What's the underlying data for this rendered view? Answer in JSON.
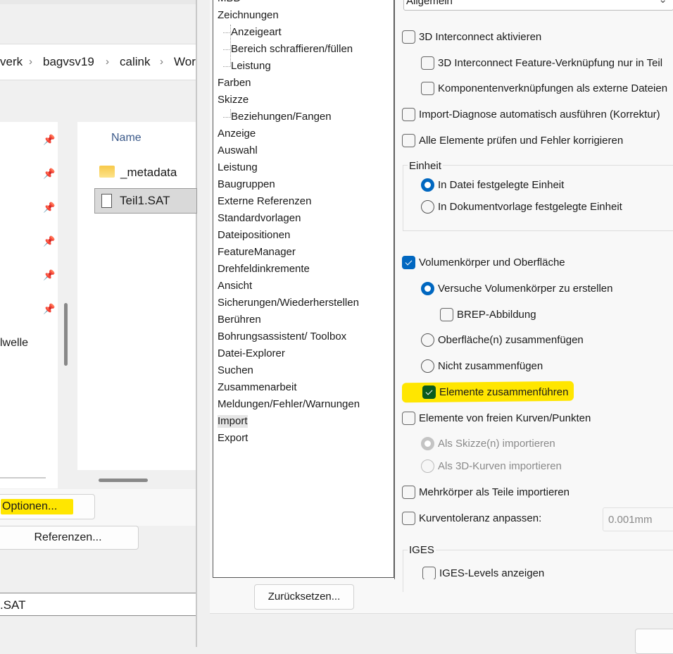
{
  "explorer": {
    "breadcrumb": [
      "verk",
      "bagvsv19",
      "calink",
      "Wor"
    ],
    "column_name": "Name",
    "files": [
      {
        "name": "_metadata",
        "icon": "folder-icon"
      },
      {
        "name": "Teil1.SAT",
        "icon": "file-icon"
      }
    ],
    "nav_partial_item": "lwelle",
    "options_button": "Optionen...",
    "references_button": "Referenzen...",
    "filename_value": ".SAT",
    "highlight_color": "#ffe600"
  },
  "tree": {
    "items": [
      {
        "label": "MBD"
      },
      {
        "label": "Zeichnungen"
      },
      {
        "label": "Anzeigeart",
        "child": true
      },
      {
        "label": "Bereich schraffieren/füllen",
        "child": true
      },
      {
        "label": "Leistung",
        "child": true
      },
      {
        "label": "Farben"
      },
      {
        "label": "Skizze"
      },
      {
        "label": "Beziehungen/Fangen",
        "child": true
      },
      {
        "label": "Anzeige"
      },
      {
        "label": "Auswahl"
      },
      {
        "label": "Leistung"
      },
      {
        "label": "Baugruppen"
      },
      {
        "label": "Externe Referenzen"
      },
      {
        "label": "Standardvorlagen"
      },
      {
        "label": "Dateipositionen"
      },
      {
        "label": "FeatureManager"
      },
      {
        "label": "Drehfeldinkremente"
      },
      {
        "label": "Ansicht"
      },
      {
        "label": "Sicherungen/Wiederherstellen"
      },
      {
        "label": "Berühren"
      },
      {
        "label": "Bohrungsassistent/ Toolbox"
      },
      {
        "label": "Datei-Explorer"
      },
      {
        "label": "Suchen"
      },
      {
        "label": "Zusammenarbeit"
      },
      {
        "label": "Meldungen/Fehler/Warnungen"
      },
      {
        "label": "Import",
        "selected": true
      },
      {
        "label": "Export"
      }
    ],
    "reset_button": "Zurücksetzen..."
  },
  "options": {
    "file_format": "Allgemein",
    "interconnect": "3D Interconnect aktivieren",
    "interconnect_feature": "3D Interconnect Feature-Verknüpfung nur in Teil",
    "component_links": "Komponentenverknüpfungen als externe Dateien",
    "import_diag": "Import-Diagnose automatisch ausführen (Korrektur)",
    "check_all": "Alle Elemente prüfen und Fehler korrigieren",
    "unit_group": "Einheit",
    "unit_file": "In Datei festgelegte Einheit",
    "unit_template": "In Dokumentvorlage festgelegte Einheit",
    "solid_surface": "Volumenkörper und Oberfläche",
    "try_solid": "Versuche Volumenkörper zu erstellen",
    "brep": "BREP-Abbildung",
    "knit_surfaces": "Oberfläche(n) zusammenfügen",
    "no_knit": "Nicht zusammenfügen",
    "merge_entities": "Elemente zusammenführen",
    "free_curves": "Elemente von freien Kurven/Punkten",
    "as_sketch": "Als Skizze(n) importieren",
    "as_3d_curves": "Als 3D-Kurven importieren",
    "multibody": "Mehrkörper als Teile importieren",
    "curve_tol": "Kurventoleranz anpassen:",
    "curve_tol_value": "0.001mm",
    "iges_group": "IGES",
    "iges_levels": "IGES-Levels anzeigen"
  }
}
